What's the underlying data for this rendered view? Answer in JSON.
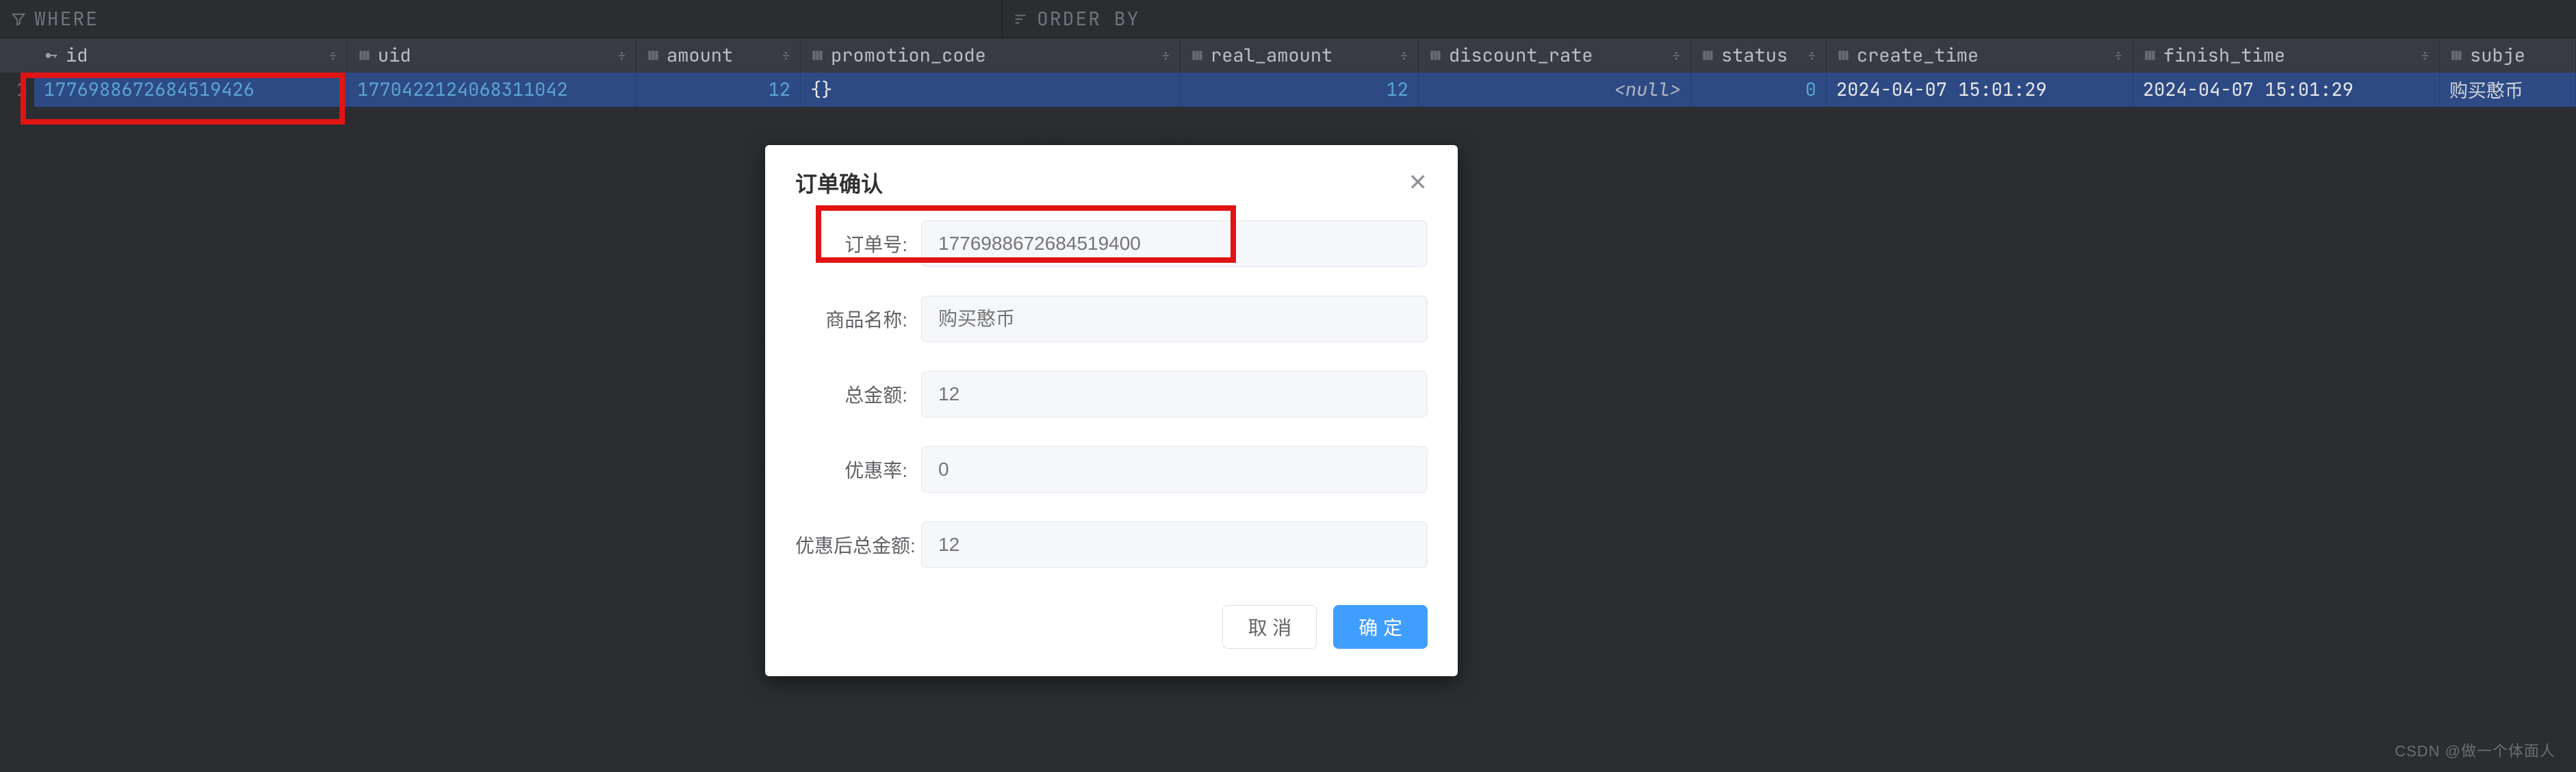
{
  "filters": {
    "where_label": "WHERE",
    "orderby_label": "ORDER BY"
  },
  "columns": {
    "id": "id",
    "uid": "uid",
    "amount": "amount",
    "promotion": "promotion_code",
    "real_amount": "real_amount",
    "discount_rate": "discount_rate",
    "status": "status",
    "create_time": "create_time",
    "finish_time": "finish_time",
    "subject": "subje"
  },
  "row": {
    "num": "1",
    "id": "1776988672684519426",
    "uid": "1770422124068311042",
    "amount": "12",
    "promotion": "{}",
    "real_amount": "12",
    "discount_rate": "<null>",
    "status": "0",
    "create_time": "2024-04-07 15:01:29",
    "finish_time": "2024-04-07 15:01:29",
    "subject": "购买憨币"
  },
  "modal": {
    "title": "订单确认",
    "labels": {
      "order_id": "订单号:",
      "product": "商品名称:",
      "total": "总金额:",
      "discount": "优惠率:",
      "after": "优惠后总金额:"
    },
    "placeholders": {
      "order_id": "1776988672684519400",
      "product": "购买憨币",
      "total": "12",
      "discount": "0",
      "after": "12"
    },
    "buttons": {
      "cancel": "取 消",
      "ok": "确 定"
    }
  },
  "watermark": "CSDN @做一个体面人"
}
